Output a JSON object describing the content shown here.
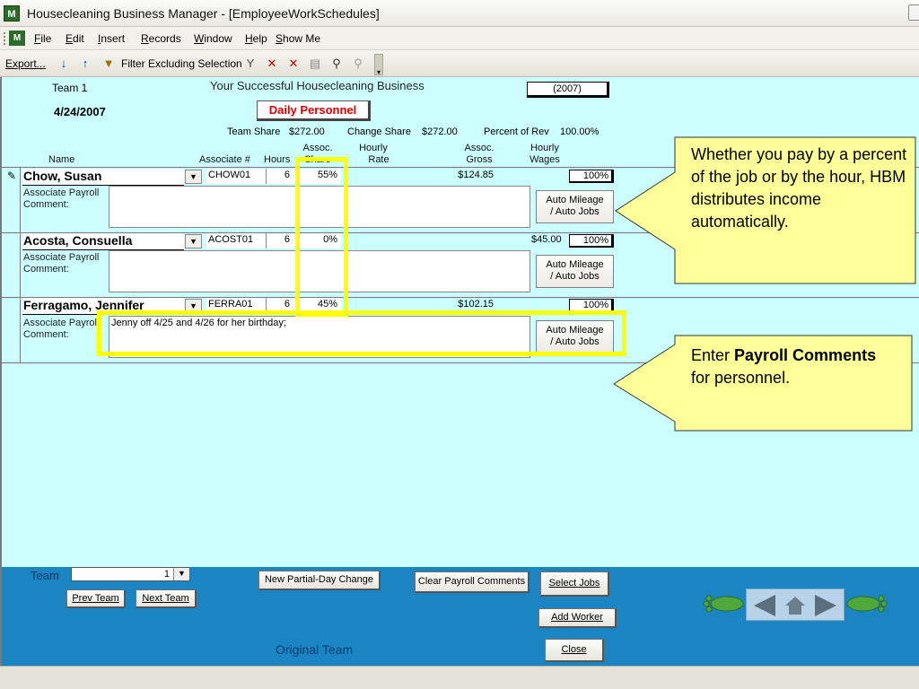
{
  "window": {
    "title": "Housecleaning Business Manager - [EmployeeWorkSchedules]"
  },
  "menu": [
    "File",
    "Edit",
    "Insert",
    "Records",
    "Window",
    "Help",
    "Show Me"
  ],
  "toolbar": {
    "export": "Export...",
    "filter": "Filter Excluding Selection"
  },
  "header": {
    "team": "Team  1",
    "business_name": "Your Successful Housecleaning Business",
    "year": "(2007)",
    "date": "4/24/2007",
    "daily_personnel": "Daily Personnel",
    "team_share_label": "Team Share",
    "team_share_value": "$272.00",
    "change_share_label": "Change Share",
    "change_share_value": "$272.00",
    "percent_rev_label": "Percent of Rev",
    "percent_rev_value": "100.00%"
  },
  "columns": {
    "name": "Name",
    "associate_num": "Associate #",
    "hours": "Hours",
    "assoc_share_1": "Assoc.",
    "assoc_share_2": "Share",
    "hourly_rate_1": "Hourly",
    "hourly_rate_2": "Rate",
    "assoc_gross_1": "Assoc.",
    "assoc_gross_2": "Gross",
    "hourly_wages_1": "Hourly",
    "hourly_wages_2": "Wages"
  },
  "employees": [
    {
      "name": "Chow, Susan",
      "id": "CHOW01",
      "hours": "6",
      "share": "55%",
      "gross": "$124.85",
      "wages": "",
      "percent": "100%",
      "payroll_label_1": "Associate Payroll",
      "payroll_label_2": "Comment:",
      "comment": "",
      "auto_btn_1": "Auto Mileage",
      "auto_btn_2": "/ Auto Jobs"
    },
    {
      "name": "Acosta, Consuella",
      "id": "ACOST01",
      "hours": "6",
      "share": "0%",
      "gross": "",
      "wages": "$45.00",
      "percent": "100%",
      "payroll_label_1": "Associate Payroll",
      "payroll_label_2": "Comment:",
      "comment": "",
      "auto_btn_1": "Auto Mileage",
      "auto_btn_2": "/ Auto Jobs"
    },
    {
      "name": "Ferragamo, Jennifer",
      "id": "FERRA01",
      "hours": "6",
      "share": "45%",
      "gross": "$102.15",
      "wages": "",
      "percent": "100%",
      "payroll_label_1": "Associate Payrol",
      "payroll_label_2": "Comment:",
      "comment": "Jenny off 4/25 and 4/26 for her birthday;",
      "auto_btn_1": "Auto Mileage",
      "auto_btn_2": "/ Auto Jobs"
    }
  ],
  "callouts": {
    "c1": "Whether you pay by a percent of the job or by the hour, HBM distributes income automatically.",
    "c2_pre": "Enter ",
    "c2_bold": "Payroll Comments",
    "c2_post": " for personnel."
  },
  "bottom": {
    "team_label": "Team",
    "team_value": "1",
    "prev_team": "Prev Team",
    "next_team": "Next Team",
    "new_partial": "New Partial-Day Change",
    "clear_payroll": "Clear Payroll Comments",
    "select_jobs": "Select Jobs",
    "add_worker": "Add Worker",
    "close": "Close",
    "original_team": "Original Team"
  },
  "colors": {
    "form_bg": "#ccffff",
    "bottom_bg": "#1b85c4",
    "highlight": "#ffff00",
    "callout": "#ffff99",
    "daily_personnel_text": "#e00000"
  }
}
